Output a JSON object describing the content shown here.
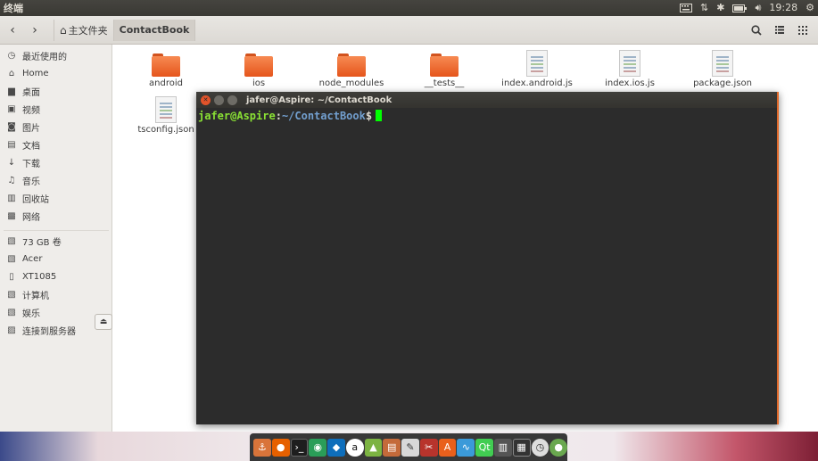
{
  "top_panel": {
    "app_title": "终端",
    "time": "19:28",
    "icons": [
      "keyboard-icon",
      "network-updown-icon",
      "bluetooth-icon",
      "battery-icon",
      "volume-icon",
      "settings-gear-icon"
    ]
  },
  "header": {
    "back_glyph": "‹",
    "forward_glyph": "›",
    "breadcrumbs": [
      {
        "label": "主文件夹"
      },
      {
        "label": "ContactBook"
      }
    ]
  },
  "sidebar": {
    "items": [
      {
        "label": "最近使用的",
        "icon": "clock-icon"
      },
      {
        "label": "Home",
        "icon": "home-icon"
      },
      {
        "label": "桌面",
        "icon": "desktop-folder-icon"
      },
      {
        "label": "视频",
        "icon": "video-icon"
      },
      {
        "label": "图片",
        "icon": "camera-icon"
      },
      {
        "label": "文档",
        "icon": "document-icon"
      },
      {
        "label": "下载",
        "icon": "download-icon"
      },
      {
        "label": "音乐",
        "icon": "music-icon"
      },
      {
        "label": "回收站",
        "icon": "trash-icon"
      },
      {
        "label": "网络",
        "icon": "network-icon"
      },
      {
        "label": "73 GB 卷",
        "icon": "drive-icon"
      },
      {
        "label": "Acer",
        "icon": "drive-icon"
      },
      {
        "label": "XT1085",
        "icon": "phone-drive-icon"
      },
      {
        "label": "计算机",
        "icon": "computer-drive-icon"
      },
      {
        "label": "娱乐",
        "icon": "drive-icon"
      },
      {
        "label": "连接到服务器",
        "icon": "server-icon"
      }
    ]
  },
  "files": [
    {
      "name": "android",
      "type": "folder"
    },
    {
      "name": "ios",
      "type": "folder"
    },
    {
      "name": "node_modules",
      "type": "folder"
    },
    {
      "name": "__tests__",
      "type": "folder"
    },
    {
      "name": "index.android.js",
      "type": "file"
    },
    {
      "name": "index.ios.js",
      "type": "file"
    },
    {
      "name": "package.json",
      "type": "file"
    },
    {
      "name": "tsconfig.json",
      "type": "file"
    }
  ],
  "terminal": {
    "title": "jafer@Aspire: ~/ContactBook",
    "prompt_user": "jafer@Aspire",
    "prompt_colon": ":",
    "prompt_path": "~/ContactBook",
    "prompt_symbol": "$"
  },
  "colors": {
    "folder_orange": "#e5551c",
    "terminal_bg": "#2c2c2c",
    "prompt_green": "#8ae234",
    "prompt_blue": "#729fcf",
    "cursor_green": "#00ff00",
    "close_button": "#e2532a"
  },
  "dock": {
    "apps": [
      "ubuntu-software-icon",
      "firefox-icon",
      "terminal-icon",
      "chrome-icon",
      "vscode-icon",
      "amazon-icon",
      "android-studio-icon",
      "files-icon",
      "text-editor-icon",
      "git-icon",
      "software-center-icon",
      "system-monitor-icon",
      "qt-icon",
      "trash-icon",
      "workspaces-icon",
      "clock-icon",
      "power-icon"
    ]
  }
}
